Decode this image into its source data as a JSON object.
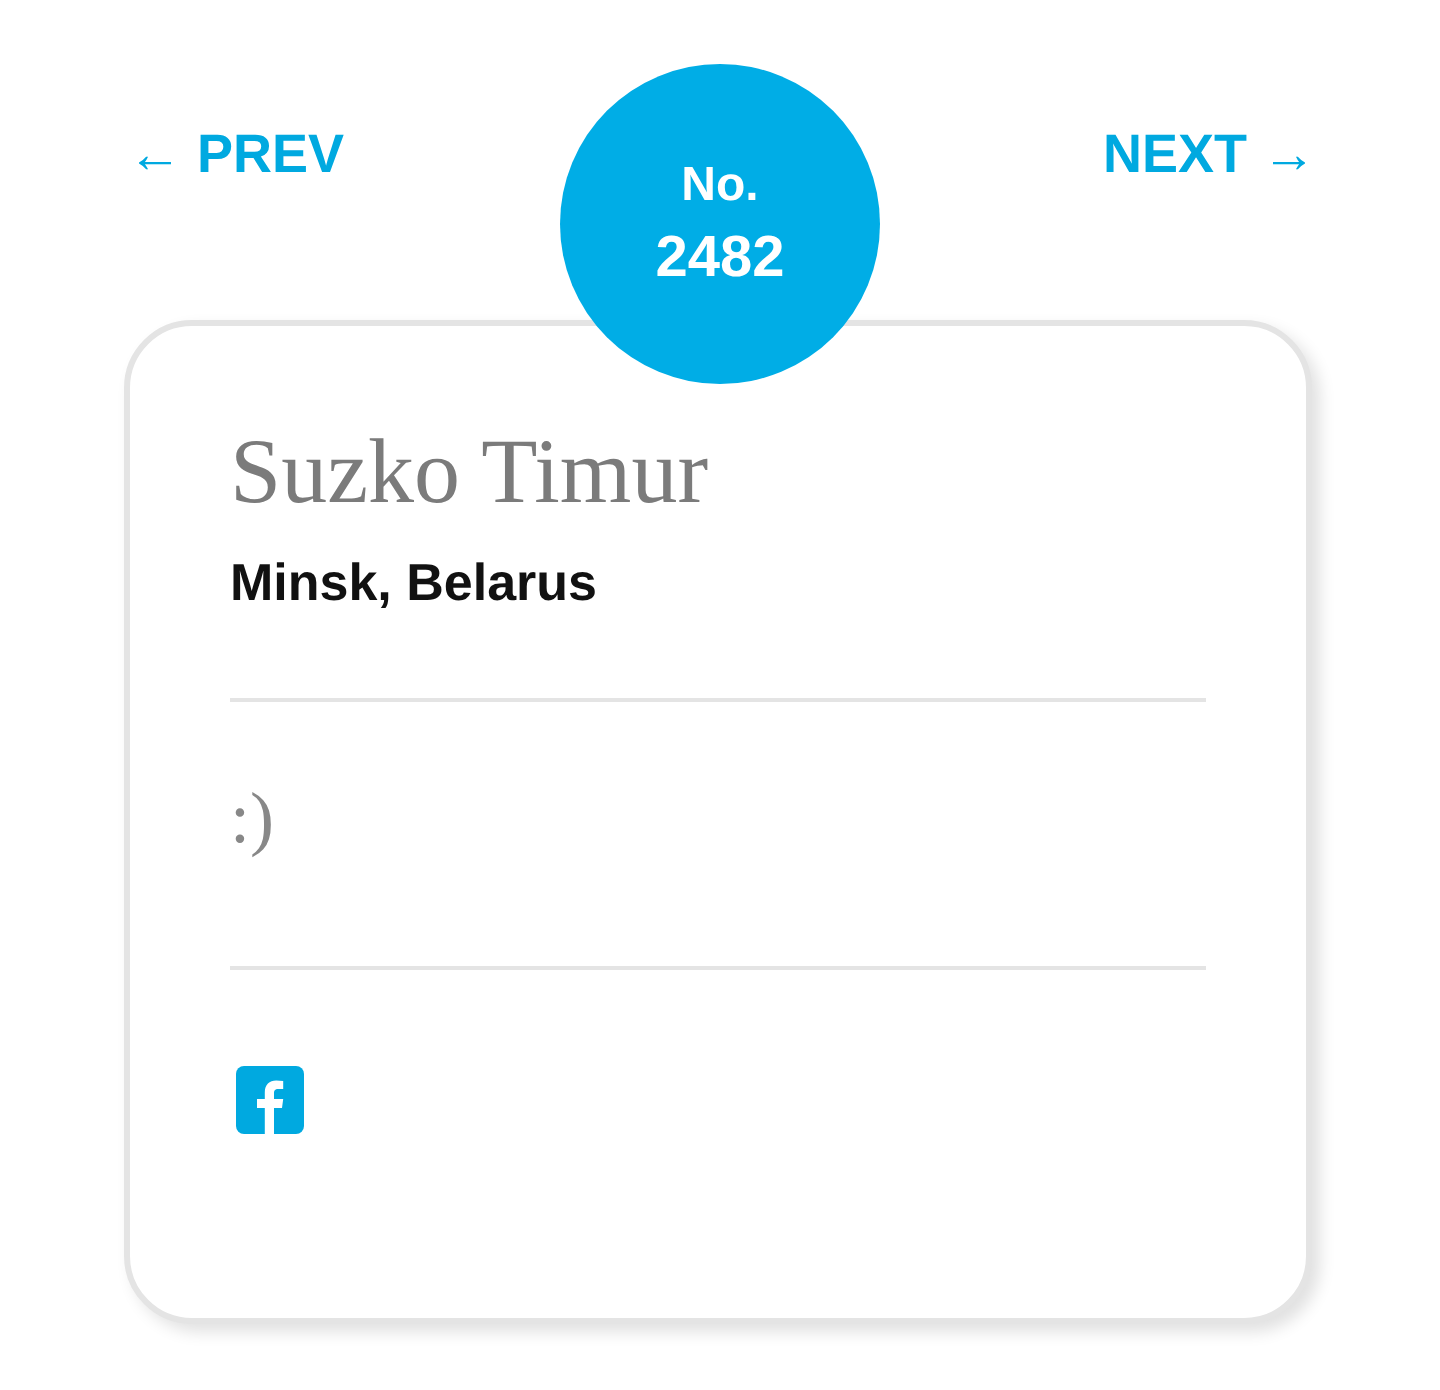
{
  "nav": {
    "prev": "← PREV",
    "next": "NEXT →"
  },
  "badge": {
    "label": "No.",
    "number": "2482"
  },
  "profile": {
    "name": "Suzko Timur",
    "location": "Minsk, Belarus",
    "bio": ":)"
  },
  "social_links": [
    {
      "kind": "facebook"
    }
  ]
}
